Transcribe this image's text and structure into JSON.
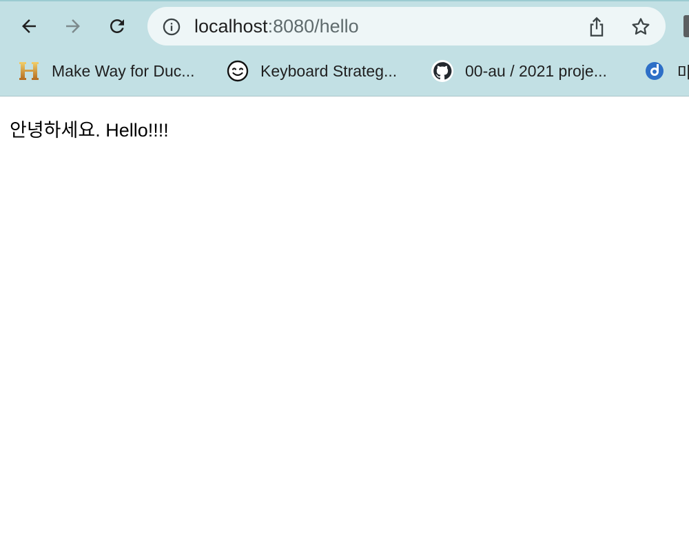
{
  "browser": {
    "address_bar": {
      "host": "localhost",
      "rest": ":8080/hello"
    },
    "nav_icons": [
      "back-arrow-icon",
      "forward-arrow-icon",
      "reload-icon"
    ],
    "omnibox_icons": [
      "info-icon",
      "share-icon",
      "star-icon"
    ],
    "bookmarks": [
      {
        "label": "Make Way for Duc...",
        "icon": "history-h-icon"
      },
      {
        "label": "Keyboard Strateg...",
        "icon": "smiley-icon"
      },
      {
        "label": "00-au / 2021 proje...",
        "icon": "github-icon"
      },
      {
        "label": "마",
        "icon": "bookmark-app-icon"
      }
    ],
    "colors": {
      "toolbar": "#c2e0e4",
      "omnibox": "#eef6f7",
      "page": "#ffffff"
    }
  },
  "page": {
    "text": "안녕하세요. Hello!!!!"
  }
}
